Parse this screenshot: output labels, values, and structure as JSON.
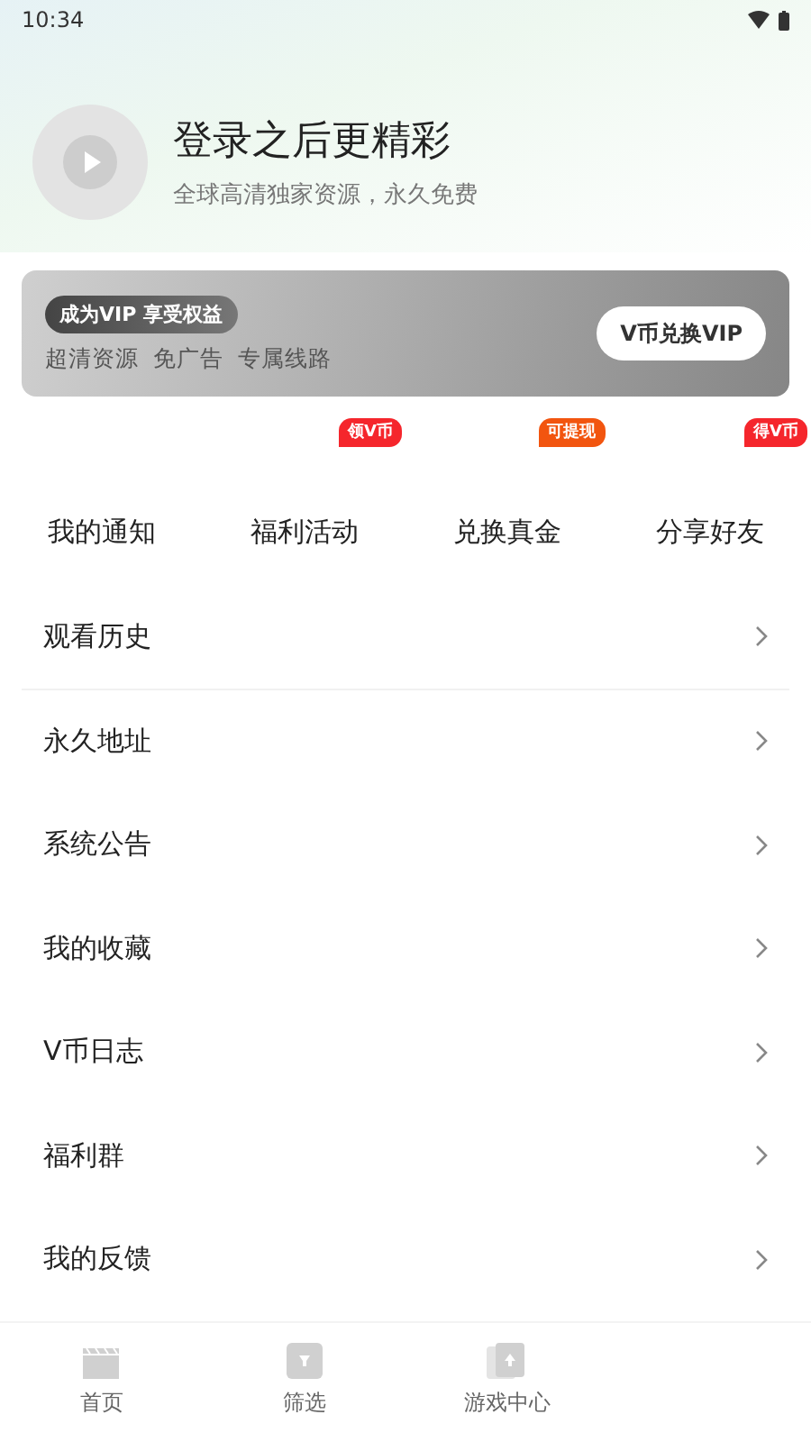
{
  "status_bar": {
    "time": "10:34"
  },
  "profile": {
    "title": "登录之后更精彩",
    "subtitle": "全球高清独家资源，永久免费"
  },
  "vip_banner": {
    "badge": "成为VIP 享受权益",
    "features": "超清资源  免广告  专属线路",
    "button": "V币兑换VIP"
  },
  "shortcuts": [
    {
      "label": "我的通知"
    },
    {
      "label": "福利活动",
      "tag": "领V币",
      "color": "#f5262c"
    },
    {
      "label": "兑换真金",
      "tag": "可提现",
      "color": "#f2550f"
    },
    {
      "label": "分享好友",
      "tag": "得V币",
      "color": "#f5262c"
    }
  ],
  "menu": [
    {
      "label": "观看历史"
    },
    {
      "label": "永久地址"
    },
    {
      "label": "系统公告"
    },
    {
      "label": "我的收藏"
    },
    {
      "label": "V币日志"
    },
    {
      "label": "福利群"
    },
    {
      "label": "我的反馈"
    }
  ],
  "bottom_nav": [
    {
      "label": "首页",
      "kind": "clapper"
    },
    {
      "label": "筛选",
      "kind": "filter"
    },
    {
      "label": "游戏中心",
      "kind": "cards"
    }
  ]
}
